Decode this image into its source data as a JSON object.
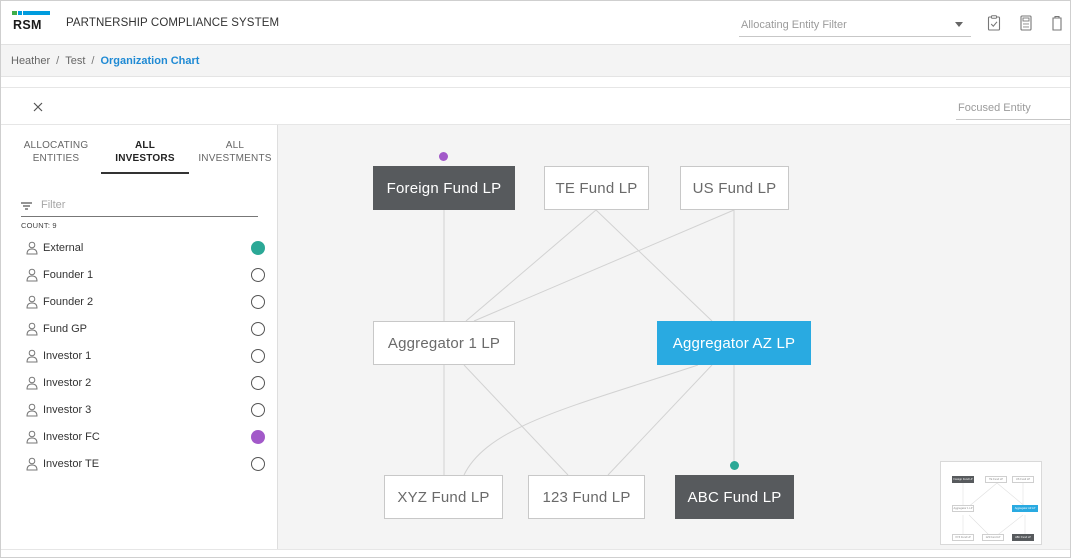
{
  "header": {
    "logo_text": "RSM",
    "app_title": "PARTNERSHIP COMPLIANCE SYSTEM",
    "entity_filter_placeholder": "Allocating Entity Filter",
    "icons": [
      "checklist-icon",
      "calculator-icon",
      "clipboard-icon"
    ]
  },
  "breadcrumb": {
    "items": [
      "Heather",
      "Test"
    ],
    "current": "Organization Chart"
  },
  "panel": {
    "focused_placeholder": "Focused Entity"
  },
  "sidebar": {
    "tabs": [
      {
        "line1": "ALLOCATING",
        "line2": "ENTITIES",
        "active": false
      },
      {
        "line1": "ALL",
        "line2": "INVESTORS",
        "active": true
      },
      {
        "line1": "ALL",
        "line2": "INVESTMENTS",
        "active": false
      }
    ],
    "filter_placeholder": "Filter",
    "count_label": "COUNT: 9",
    "investors": [
      {
        "name": "External",
        "marker": "#2ba896"
      },
      {
        "name": "Founder 1",
        "marker": ""
      },
      {
        "name": "Founder 2",
        "marker": ""
      },
      {
        "name": "Fund GP",
        "marker": ""
      },
      {
        "name": "Investor 1",
        "marker": ""
      },
      {
        "name": "Investor 2",
        "marker": ""
      },
      {
        "name": "Investor 3",
        "marker": ""
      },
      {
        "name": "Investor FC",
        "marker": "#a259c9"
      },
      {
        "name": "Investor TE",
        "marker": ""
      }
    ]
  },
  "chart": {
    "nodes": {
      "foreign": "Foreign Fund LP",
      "te": "TE Fund LP",
      "us": "US Fund LP",
      "agg1": "Aggregator 1 LP",
      "aggaz": "Aggregator AZ LP",
      "xyz": "XYZ Fund LP",
      "f123": "123 Fund LP",
      "abc": "ABC Fund LP"
    },
    "colors": {
      "dark_node": "#575a5d",
      "selected_node": "#29aae1",
      "investor_fc_dot": "#a259c9",
      "external_dot": "#2ba896"
    }
  },
  "minimap": {
    "nodes": [
      "Foreign Fund LP",
      "TE Fund LP",
      "US Fund LP",
      "Aggregator 1 LP",
      "Aggregator AZ LP",
      "XYZ Fund LP",
      "123 Fund LP",
      "ABC Fund LP"
    ]
  }
}
